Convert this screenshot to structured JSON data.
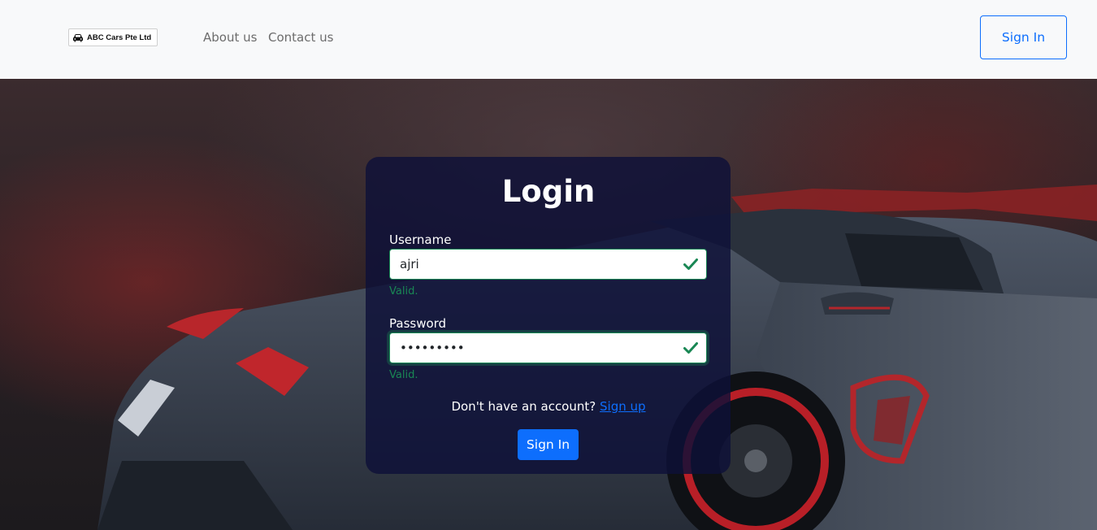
{
  "navbar": {
    "logo_text": "ABC Cars Pte Ltd",
    "links": [
      {
        "label": "About us"
      },
      {
        "label": "Contact us"
      }
    ],
    "signin_label": "Sign In"
  },
  "login": {
    "title": "Login",
    "username_label": "Username",
    "username_value": "ajri",
    "username_feedback": "Valid.",
    "password_label": "Password",
    "password_value": "•••••••••",
    "password_feedback": "Valid.",
    "no_account_text": "Don't have an account?",
    "signup_link": "Sign up",
    "submit_label": "Sign In"
  },
  "colors": {
    "primary": "#0d6efd",
    "success": "#198754",
    "navbar_bg": "#f8f9fa",
    "card_bg": "#0e1038"
  },
  "icons": {
    "logo": "car-icon",
    "valid": "check-icon"
  }
}
